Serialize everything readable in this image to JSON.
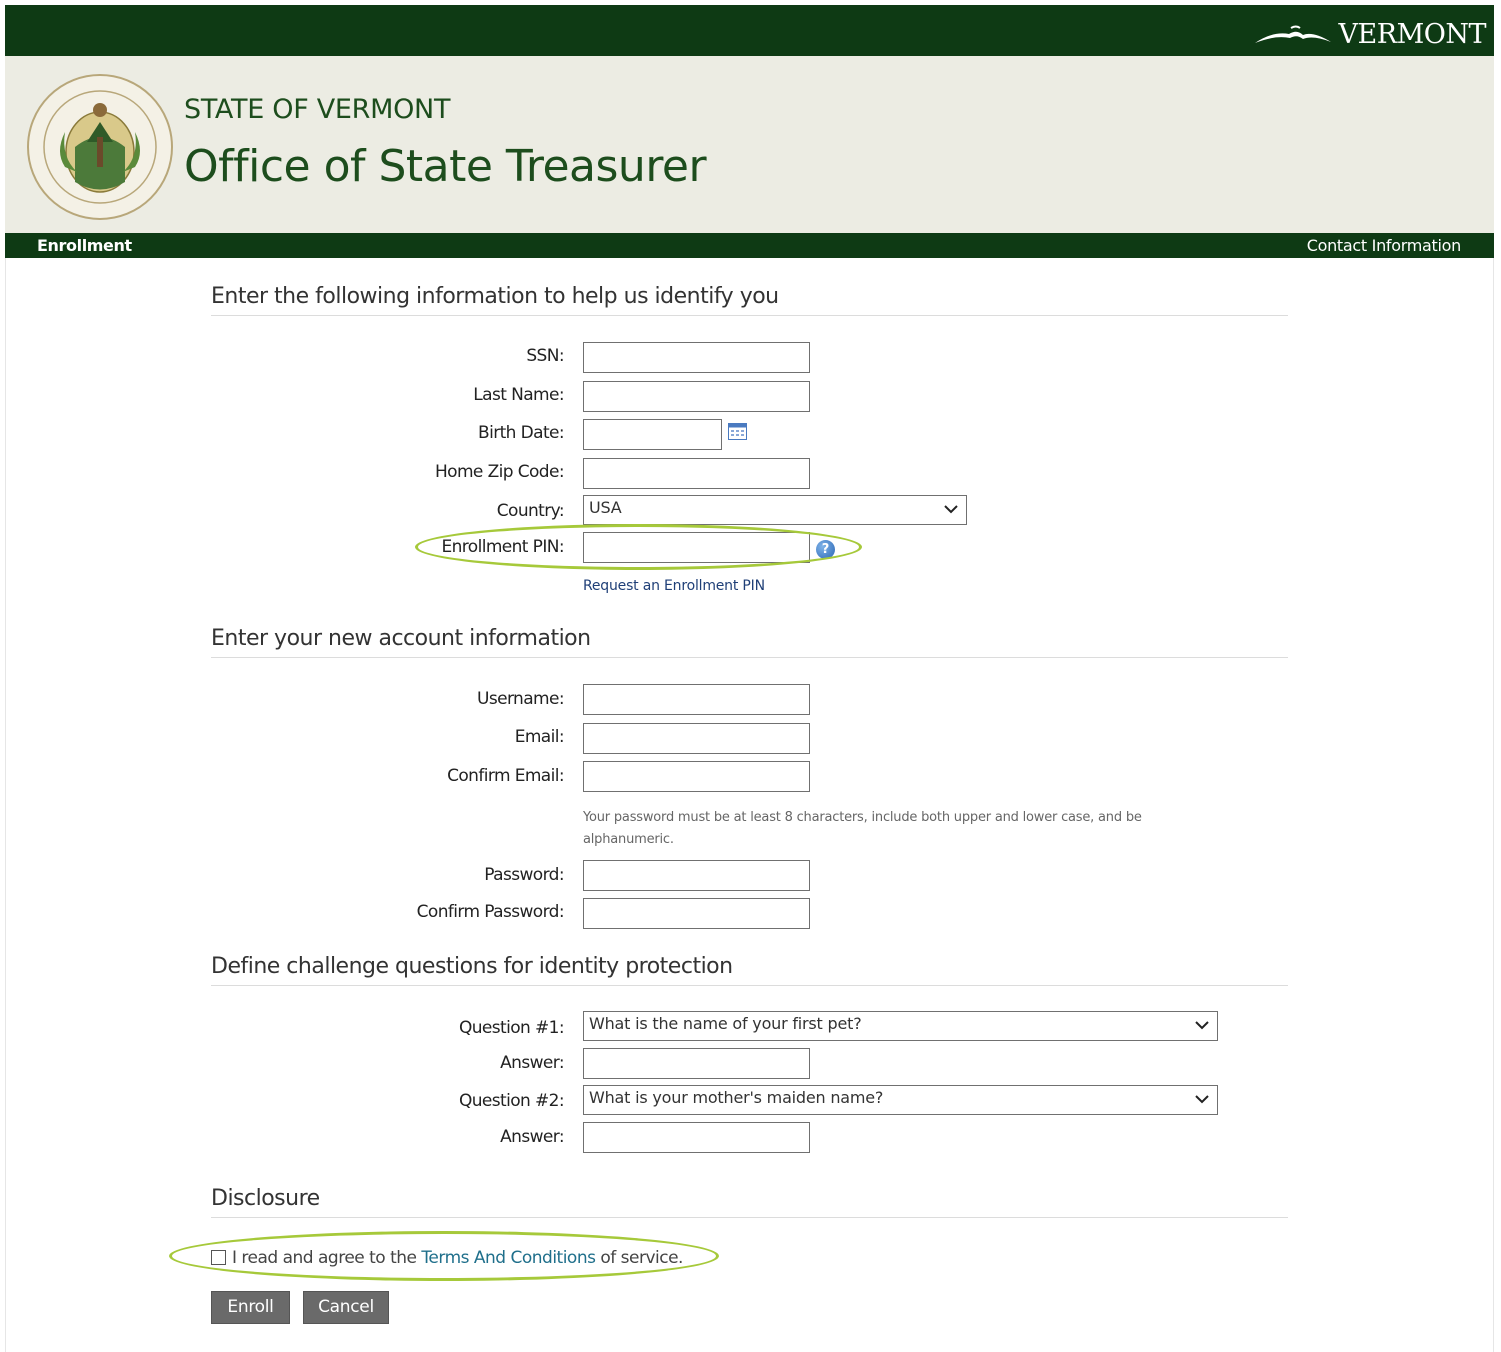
{
  "header": {
    "brand": "VERMONT",
    "state_title": "STATE OF VERMONT",
    "office_title": "Office of State Treasurer"
  },
  "nav": {
    "current": "Enrollment",
    "contact": "Contact Information"
  },
  "identify": {
    "title": "Enter the following information to help us identify you",
    "ssn_label": "SSN:",
    "lastname_label": "Last Name:",
    "birthdate_label": "Birth Date:",
    "zip_label": "Home Zip Code:",
    "country_label": "Country:",
    "country_value": "USA",
    "pin_label": "Enrollment PIN:",
    "request_pin_link": "Request an Enrollment PIN"
  },
  "account": {
    "title": "Enter your new account information",
    "username_label": "Username:",
    "email_label": "Email:",
    "confirm_email_label": "Confirm Email:",
    "password_hint": "Your password must be at least 8 characters, include both upper and lower case, and be alphanumeric.",
    "password_label": "Password:",
    "confirm_password_label": "Confirm Password:"
  },
  "challenge": {
    "title": "Define challenge questions for identity protection",
    "q1_label": "Question #1:",
    "q1_value": "What is the name of your first pet?",
    "answer1_label": "Answer:",
    "q2_label": "Question #2:",
    "q2_value": "What is your mother's maiden name?",
    "answer2_label": "Answer:"
  },
  "disclosure": {
    "title": "Disclosure",
    "agree_prefix": "I read and agree to the ",
    "terms_link": "Terms And Conditions",
    "agree_suffix": " of service."
  },
  "buttons": {
    "enroll": "Enroll",
    "cancel": "Cancel"
  },
  "colors": {
    "header_green": "#0e3a14",
    "banner_bg": "#ecece3",
    "highlight": "#a6c93a"
  }
}
